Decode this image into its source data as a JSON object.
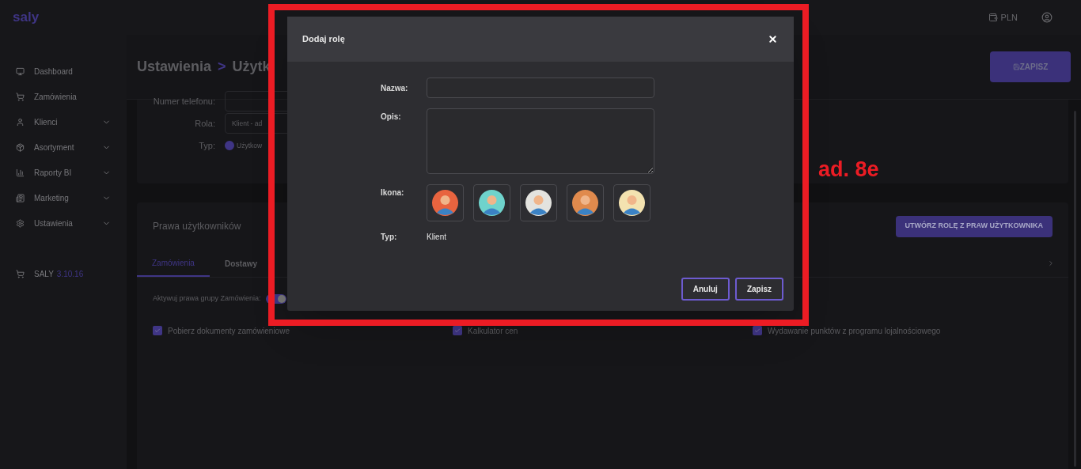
{
  "brand": "saly",
  "topbar": {
    "currency": "PLN"
  },
  "sidebar": {
    "items": [
      {
        "label": "Dashboard",
        "kind": "monitor",
        "expandable": false
      },
      {
        "label": "Zamówienia",
        "kind": "cart",
        "expandable": false
      },
      {
        "label": "Klienci",
        "kind": "user",
        "expandable": true
      },
      {
        "label": "Asortyment",
        "kind": "box",
        "expandable": true
      },
      {
        "label": "Raporty BI",
        "kind": "chart",
        "expandable": true
      },
      {
        "label": "Marketing",
        "kind": "news",
        "expandable": true
      },
      {
        "label": "Ustawienia",
        "kind": "gear",
        "expandable": true
      }
    ],
    "version_label": "SALY",
    "version": "3.10.16"
  },
  "header": {
    "breadcrumb": [
      "Ustawienia",
      ">",
      "Użytk"
    ],
    "save_button": "ZAPISZ"
  },
  "user_form": {
    "fields": [
      {
        "label": "Numer telefonu:"
      },
      {
        "label": "Rola:",
        "value": "Klient - ad"
      }
    ],
    "type_label": "Typ:",
    "type_option": {
      "label": "Użytkow",
      "selected": true
    }
  },
  "rights": {
    "title": "Prawa użytkowników",
    "create_button": "UTWÓRZ ROLĘ Z PRAW UŻYTKOWNIKA",
    "tabs": [
      {
        "label": "Zamówienia",
        "selected": true
      },
      {
        "label": "Dostawy",
        "selected": false
      }
    ],
    "toggle": {
      "label": "Aktywuj prawa grupy Zamówienia:",
      "on": true
    },
    "permissions": [
      {
        "label": "Pobierz dokumenty zamówieniowe",
        "checked": true
      },
      {
        "label": "Kalkulator cen",
        "checked": true
      },
      {
        "label": "Wydawanie punktów z programu lojalnościowego",
        "checked": true
      }
    ]
  },
  "dialog": {
    "title": "Dodaj rolę",
    "name_label": "Nazwa:",
    "description_label": "Opis:",
    "icon_label": "Ikona:",
    "icons": [
      {
        "color": "#e8643f",
        "selected": false
      },
      {
        "color": "#6fd3cc",
        "selected": false
      },
      {
        "color": "#e3e3df",
        "selected": false
      },
      {
        "color": "#e08a4d",
        "selected": false
      },
      {
        "color": "#f3e2b0",
        "selected": false
      }
    ],
    "type_label": "Typ:",
    "type_value": "Klient",
    "cancel_button": "Anuluj",
    "save_button": "Zapisz"
  },
  "annotation": {
    "text": "ad. 8e"
  }
}
